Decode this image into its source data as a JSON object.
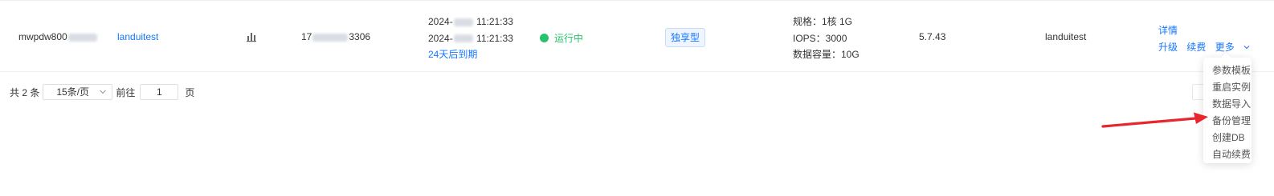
{
  "row": {
    "name_prefix": "mwpdw800",
    "remark": "landuitest",
    "ip_prefix": "17",
    "ip_suffix": "3306",
    "create_time_prefix": "2024-",
    "create_time_suffix": "11:21:33",
    "expire_time_prefix": "2024-",
    "expire_time_suffix": "11:21:33",
    "expire_note": "24天后到期",
    "status": "运行中",
    "type_tag": "独享型",
    "spec": "规格：1核 1G",
    "iops": "IOPS：3000",
    "data_capacity": "数据容量：10G",
    "version": "5.7.43",
    "tag": "landuitest",
    "actions": {
      "detail": "详情",
      "upgrade": "升级",
      "renew": "续费",
      "more": "更多"
    }
  },
  "pagination": {
    "total": "共 2 条",
    "page_size": "15条/页",
    "goto": "前往",
    "page_value": "1",
    "page_unit": "页"
  },
  "more_menu": {
    "items": [
      "参数模板",
      "重启实例",
      "数据导入",
      "备份管理",
      "创建DB",
      "自动续费"
    ]
  },
  "colors": {
    "link": "#1677ff",
    "running": "#27c26f",
    "annotation_arrow": "#e8262e"
  },
  "icons": {
    "monitor": "bar-chart-icon",
    "more": "chevron-down-icon"
  }
}
